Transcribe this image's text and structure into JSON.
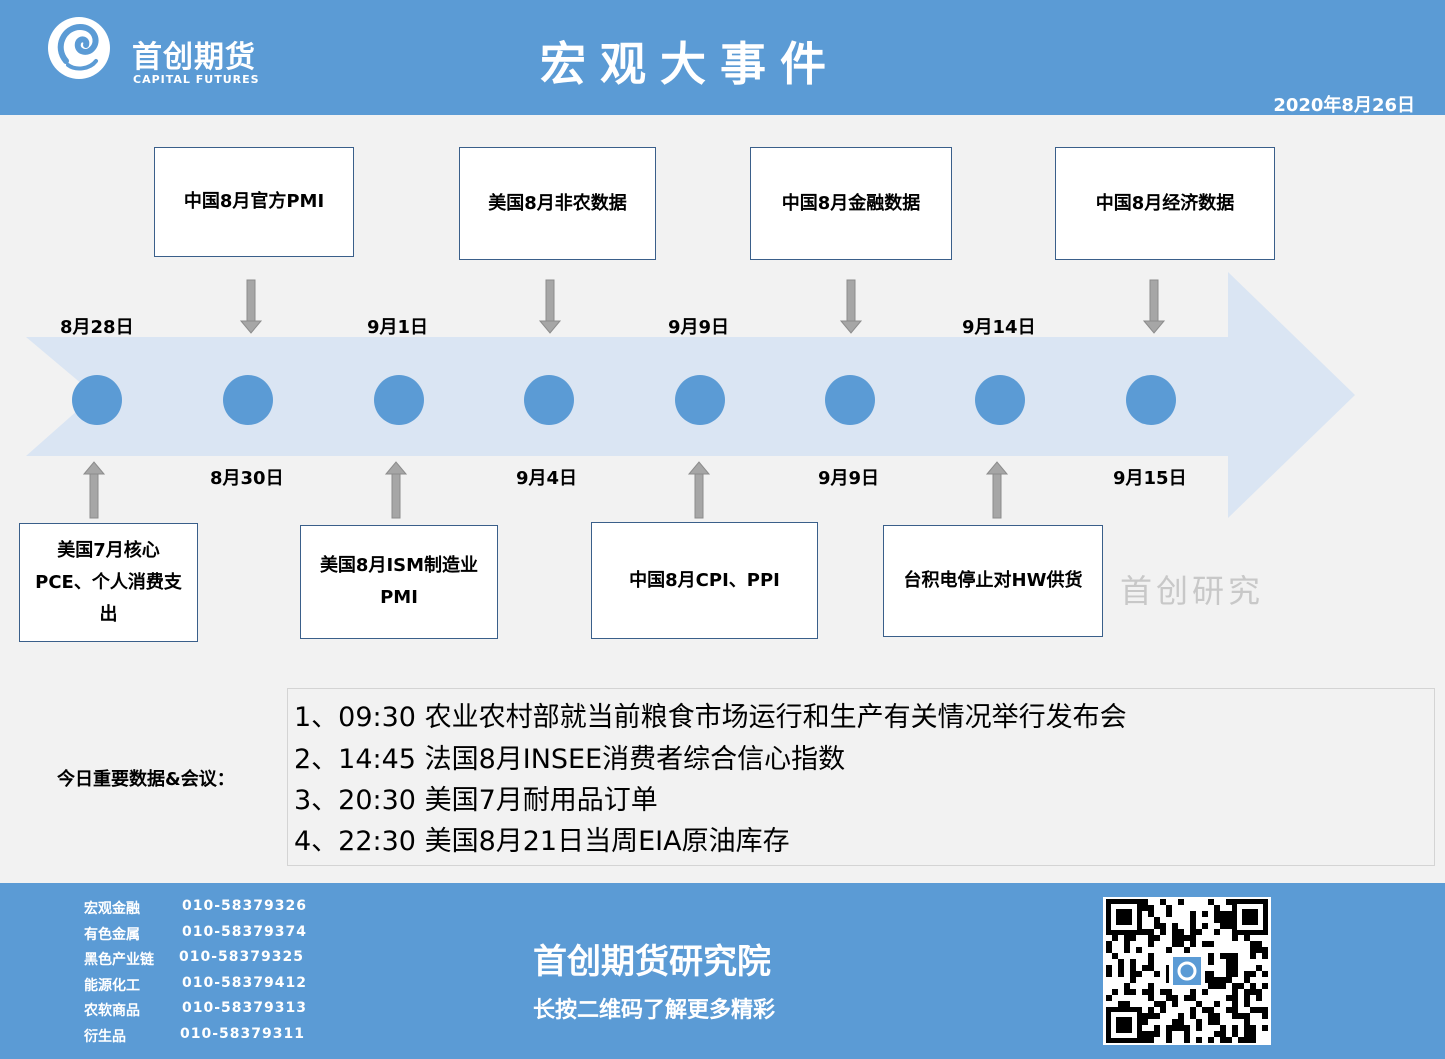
{
  "header": {
    "logo_cn": "首创期货",
    "logo_en": "CAPITAL FUTURES",
    "title": "宏观大事件",
    "date": "2020年8月26日"
  },
  "timeline": {
    "dates_top": [
      "8月28日",
      "9月1日",
      "9月9日",
      "9月14日"
    ],
    "dates_bottom": [
      "8月30日",
      "9月4日",
      "9月9日",
      "9月15日"
    ],
    "events_top": [
      "中国8月官方PMI",
      "美国8月非农数据",
      "中国8月金融数据",
      "中国8月经济数据"
    ],
    "events_bottom": [
      [
        "美国7月核心",
        "PCE、个人消费支",
        "出"
      ],
      [
        "美国8月ISM制造业",
        "PMI"
      ],
      [
        "中国8月CPI、PPI"
      ],
      [
        "台积电停止对HW供货"
      ]
    ],
    "watermark": "首创研究",
    "colors": {
      "arrow": "#dae5f3",
      "node": "#5b9bd5",
      "pointer": "#a6a6a6"
    }
  },
  "today": {
    "label": "今日重要数据&会议：",
    "items": [
      "1、09:30 农业农村部就当前粮食市场运行和生产有关情况举行发布会",
      "2、14:45 法国8月INSEE消费者综合信心指数",
      "3、20:30 美国7月耐用品订单",
      "4、22:30 美国8月21日当周EIA原油库存"
    ]
  },
  "footer": {
    "contacts": [
      {
        "dept": "宏观金融",
        "phone": "010-58379326"
      },
      {
        "dept": "有色金属",
        "phone": "010-58379374"
      },
      {
        "dept": "黑色产业链",
        "phone": "010-58379325"
      },
      {
        "dept": "能源化工",
        "phone": "010-58379412"
      },
      {
        "dept": "农软商品",
        "phone": "010-58379313"
      },
      {
        "dept": "衍生品",
        "phone": "010-58379311"
      }
    ],
    "title": "首创期货研究院",
    "subtitle": "长按二维码了解更多精彩",
    "brand_color": "#5b9bd5"
  }
}
